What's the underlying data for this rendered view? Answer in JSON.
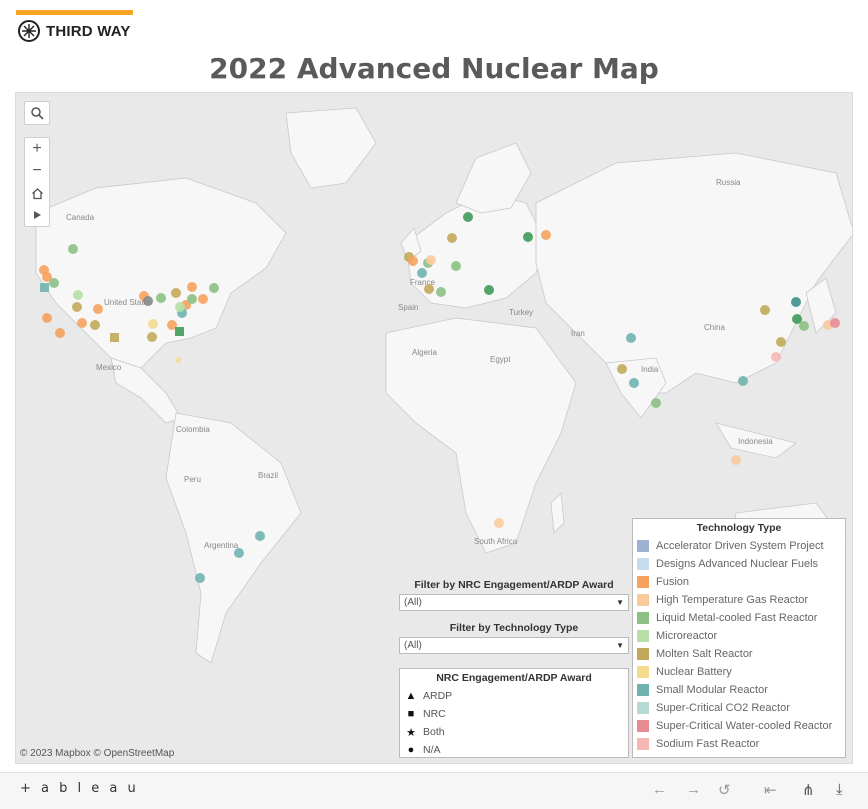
{
  "brand": {
    "name": "THIRD WAY",
    "accent": "#f5a623"
  },
  "title": "2022 Advanced Nuclear Map",
  "map": {
    "attribution": "© 2023 Mapbox © OpenStreetMap",
    "labels": [
      "Canada",
      "United States",
      "Mexico",
      "Russia",
      "China",
      "India",
      "Iran",
      "Turkey",
      "Egypt",
      "Algeria",
      "Spain",
      "France",
      "Colombia",
      "Brazil",
      "Peru",
      "Argentina",
      "South Africa",
      "Indonesia"
    ],
    "controls": {
      "search": "search-icon",
      "zoom_in": "+",
      "zoom_out": "−",
      "home": "home-icon",
      "play": "play-icon"
    }
  },
  "filters": {
    "nrc": {
      "label": "Filter by NRC Engagement/ARDP Award",
      "value": "(All)"
    },
    "tech": {
      "label": "Filter by Technology Type",
      "value": "(All)"
    }
  },
  "shape_legend": {
    "title": "NRC Engagement/ARDP Award",
    "items": [
      {
        "symbol": "▲",
        "label": "ARDP"
      },
      {
        "symbol": "■",
        "label": "NRC"
      },
      {
        "symbol": "★",
        "label": "Both"
      },
      {
        "symbol": "●",
        "label": "N/A"
      }
    ]
  },
  "tech_legend": {
    "title": "Technology Type",
    "items": [
      {
        "label": "Accelerator Driven System Project",
        "color": "#9eb3cf"
      },
      {
        "label": "Designs Advanced Nuclear Fuels",
        "color": "#c7dcef"
      },
      {
        "label": "Fusion",
        "color": "#f5a25d"
      },
      {
        "label": "High Temperature Gas Reactor",
        "color": "#f9cb9c"
      },
      {
        "label": "Liquid Metal-cooled Fast Reactor",
        "color": "#8cc084"
      },
      {
        "label": "Microreactor",
        "color": "#b7dfa6"
      },
      {
        "label": "Molten Salt Reactor",
        "color": "#c2a85b"
      },
      {
        "label": "Nuclear Battery",
        "color": "#f3dc8e"
      },
      {
        "label": "Small Modular Reactor",
        "color": "#6fb2b0"
      },
      {
        "label": "Super-Critical CO2 Reactor",
        "color": "#b7d9d6"
      },
      {
        "label": "Super-Critical Water-cooled Reactor",
        "color": "#e88c93"
      },
      {
        "label": "Sodium Fast Reactor",
        "color": "#f7b6b6"
      }
    ]
  },
  "footer": {
    "logo": "+ a b l e a u"
  }
}
